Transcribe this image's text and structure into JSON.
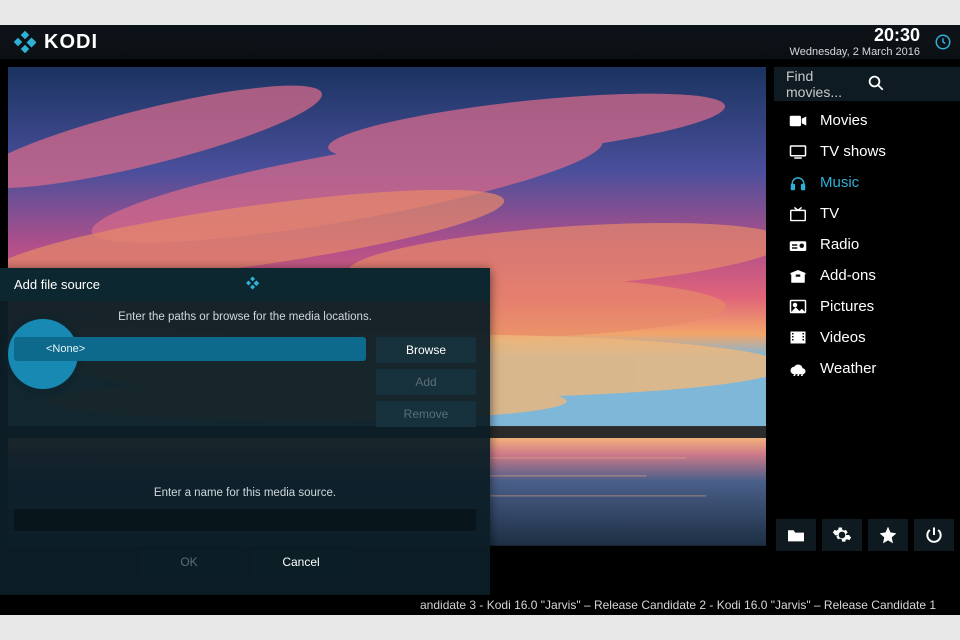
{
  "header": {
    "brand": "KODI",
    "time": "20:30",
    "date": "Wednesday, 2 March 2016"
  },
  "search": {
    "placeholder": "Find movies..."
  },
  "menu": {
    "items": [
      {
        "icon": "video-camera",
        "label": "Movies",
        "active": false
      },
      {
        "icon": "tv-screen",
        "label": "TV shows",
        "active": false
      },
      {
        "icon": "headphones",
        "label": "Music",
        "active": true
      },
      {
        "icon": "tv-live",
        "label": "TV",
        "active": false
      },
      {
        "icon": "radio",
        "label": "Radio",
        "active": false
      },
      {
        "icon": "box",
        "label": "Add-ons",
        "active": false
      },
      {
        "icon": "image",
        "label": "Pictures",
        "active": false
      },
      {
        "icon": "film",
        "label": "Videos",
        "active": false
      },
      {
        "icon": "cloud",
        "label": "Weather",
        "active": false
      }
    ]
  },
  "bottom_icons": [
    "folder",
    "gear",
    "star",
    "power"
  ],
  "dialog": {
    "title": "Add file source",
    "hint_paths": "Enter the paths or browse for the media locations.",
    "path_value": "<None>",
    "bubble_value": "<None>",
    "browse": "Browse",
    "add": "Add",
    "remove": "Remove",
    "hint_name": "Enter a name for this media source.",
    "name_value": "",
    "ok": "OK",
    "cancel": "Cancel"
  },
  "ticker": "andidate 3 - Kodi 16.0 \"Jarvis\" – Release Candidate 2 - Kodi 16.0 \"Jarvis\" – Release Candidate 1",
  "colors": {
    "accent": "#2fb0d6",
    "panel": "#0c1e26"
  }
}
